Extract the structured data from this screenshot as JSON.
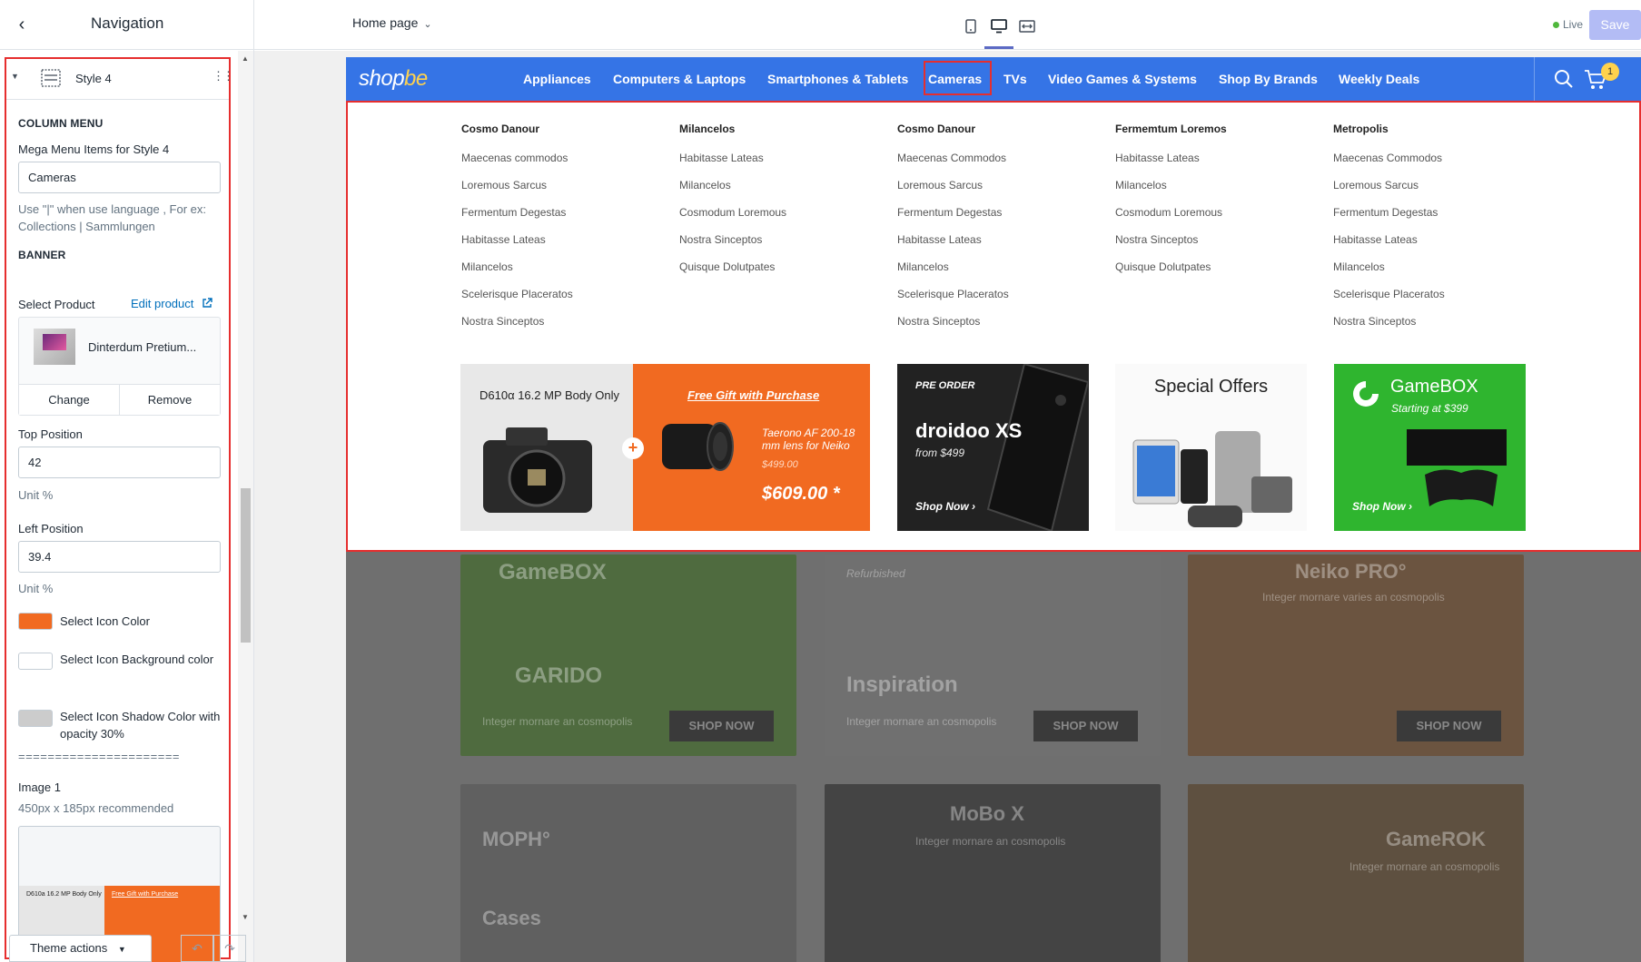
{
  "topbar": {
    "back_icon": "back-chevron-icon",
    "title": "Navigation",
    "page_select": "Home page",
    "devices": [
      "mobile-icon",
      "desktop-icon",
      "fullwidth-icon"
    ],
    "live_label": "Live",
    "save_label": "Save",
    "colors": {
      "live": "#50b83c",
      "save": "#b3bcf5",
      "accent": "#5c6ac4"
    }
  },
  "sidebar": {
    "style_label": "Style 4",
    "column_menu": {
      "heading": "COLUMN MENU",
      "items_label": "Mega Menu Items for Style 4",
      "items_value": "Cameras",
      "help": "Use \"|\" when use language , For ex: Collections | Sammlungen"
    },
    "banner": {
      "heading": "BANNER",
      "select_product_label": "Select Product",
      "edit_product_label": "Edit product",
      "product_name": "Dinterdum Pretium...",
      "change_label": "Change",
      "remove_label": "Remove",
      "top_position_label": "Top Position",
      "top_position_value": "42",
      "top_unit": "Unit %",
      "left_position_label": "Left Position",
      "left_position_value": "39.4",
      "left_unit": "Unit %",
      "icon_color_label": "Select Icon Color",
      "icon_color": "#f16a21",
      "icon_bg_label": "Select Icon Background color",
      "icon_bg_color": "#ffffff",
      "icon_shadow_label": "Select Icon Shadow Color with opacity 30%",
      "icon_shadow_color": "#cccccc",
      "divider": "======================",
      "image_label": "Image 1",
      "image_help": "450px x 185px recommended",
      "preview_left": "D610a 16.2 MP Body Only",
      "preview_right": "Free Gift with Purchase"
    },
    "theme_actions_label": "Theme actions"
  },
  "store": {
    "logo_main": "shop",
    "logo_accent": "be",
    "nav": [
      "Appliances",
      "Computers & Laptops",
      "Smartphones & Tablets",
      "Cameras",
      "TVs",
      "Video Games & Systems",
      "Shop By Brands",
      "Weekly Deals"
    ],
    "cart_count": "1",
    "columns": [
      {
        "title": "Cosmo Danour",
        "items": [
          "Maecenas commodos",
          "Loremous Sarcus",
          "Fermentum Degestas",
          "Habitasse Lateas",
          "Milancelos",
          "Scelerisque Placeratos",
          "Nostra Sinceptos"
        ]
      },
      {
        "title": "Milancelos",
        "items": [
          "Habitasse Lateas",
          "Milancelos",
          "Cosmodum Loremous",
          "Nostra Sinceptos",
          "Quisque Dolutpates"
        ]
      },
      {
        "title": "Cosmo Danour",
        "items": [
          "Maecenas Commodos",
          "Loremous Sarcus",
          "Fermentum Degestas",
          "Habitasse Lateas",
          "Milancelos",
          "Scelerisque Placeratos",
          "Nostra Sinceptos"
        ]
      },
      {
        "title": "Fermemtum Loremos",
        "items": [
          "Habitasse Lateas",
          "Milancelos",
          "Cosmodum Loremous",
          "Nostra Sinceptos",
          "Quisque Dolutpates"
        ]
      },
      {
        "title": "Metropolis",
        "items": [
          "Maecenas Commodos",
          "Loremous Sarcus",
          "Fermentum Degestas",
          "Habitasse Lateas",
          "Milancelos",
          "Scelerisque Placeratos",
          "Nostra Sinceptos"
        ]
      }
    ],
    "banners": {
      "camera_left": "D610α 16.2 MP Body Only",
      "camera_gift": "Free Gift with Purchase",
      "camera_lens": "Taerono AF 200-18 mm lens for Neiko",
      "camera_old_price": "$499.00",
      "camera_price": "$609.00 *",
      "phone_preorder": "PRE ORDER",
      "phone_name": "droidoo XS",
      "phone_from": "from $499",
      "phone_shop": "Shop Now",
      "offers_title": "Special Offers",
      "game_name": "GameBOX",
      "game_start": "Starting at $399",
      "game_shop": "Shop Now"
    },
    "background": {
      "card1_title": "GameBOX",
      "card1_brand": "GARIDO",
      "card1_text": "Integer mornare an cosmopolis",
      "card2_tag": "Refurbished",
      "card2_title": "Inspiration",
      "card2_text": "Integer mornare an cosmopolis",
      "card3_title": "Neiko PRO°",
      "card3_text": "Integer mornare varies an cosmopolis",
      "shop_now": "SHOP NOW",
      "card4_title": "MOPH°",
      "card4_sub": "Cases",
      "card5_title": "MoBo X",
      "card5_text": "Integer mornare an cosmopolis",
      "card6_title": "GameROK",
      "card6_text": "Integer mornare an cosmopolis"
    }
  }
}
